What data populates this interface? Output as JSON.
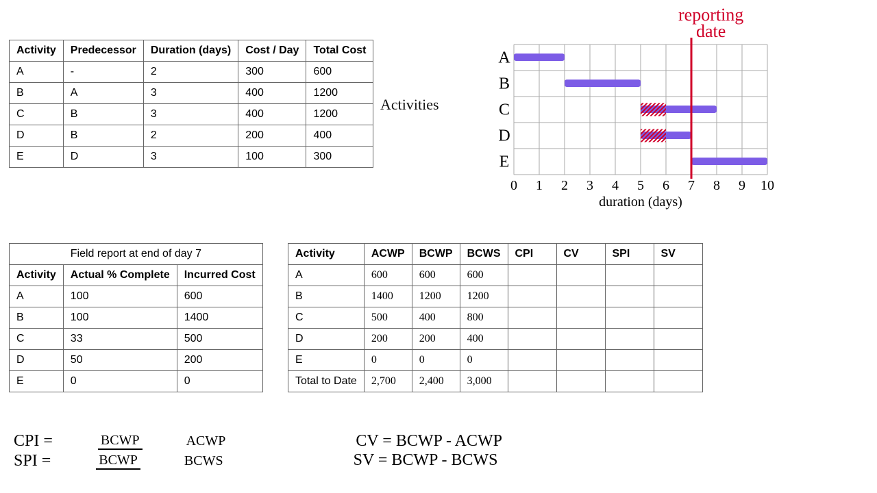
{
  "table1": {
    "headers": [
      "Activity",
      "Predecessor",
      "Duration (days)",
      "Cost / Day",
      "Total Cost"
    ],
    "rows": [
      [
        "A",
        "-",
        "2",
        "300",
        "600"
      ],
      [
        "B",
        "A",
        "3",
        "400",
        "1200"
      ],
      [
        "C",
        "B",
        "3",
        "400",
        "1200"
      ],
      [
        "D",
        "B",
        "2",
        "200",
        "400"
      ],
      [
        "E",
        "D",
        "3",
        "100",
        "300"
      ]
    ]
  },
  "table2": {
    "title": "Field report at end of day 7",
    "headers": [
      "Activity",
      "Actual % Complete",
      "Incurred Cost"
    ],
    "rows": [
      [
        "A",
        "100",
        "600"
      ],
      [
        "B",
        "100",
        "1400"
      ],
      [
        "C",
        "33",
        "500"
      ],
      [
        "D",
        "50",
        "200"
      ],
      [
        "E",
        "0",
        "0"
      ]
    ]
  },
  "table3": {
    "headers": [
      "Activity",
      "ACWP",
      "BCWP",
      "BCWS",
      "CPI",
      "CV",
      "SPI",
      "SV"
    ],
    "rows": [
      [
        "A",
        "600",
        "600",
        "600",
        "",
        "",
        "",
        ""
      ],
      [
        "B",
        "1400",
        "1200",
        "1200",
        "",
        "",
        "",
        ""
      ],
      [
        "C",
        "500",
        "400",
        "800",
        "",
        "",
        "",
        ""
      ],
      [
        "D",
        "200",
        "200",
        "400",
        "",
        "",
        "",
        ""
      ],
      [
        "E",
        "0",
        "0",
        "0",
        "",
        "",
        "",
        ""
      ],
      [
        "Total to Date",
        "2,700",
        "2,400",
        "3,000",
        "",
        "",
        "",
        ""
      ]
    ]
  },
  "labels": {
    "activities": "Activities",
    "reporting": "reporting\ndate",
    "xlabel": "duration (days)"
  },
  "formulas": {
    "cpi_lhs": "CPI =",
    "cpi_num": "BCWP",
    "cpi_den": "ACWP",
    "cv": "CV = BCWP - ACWP",
    "spi_lhs": "SPI =",
    "spi_num": "BCWP",
    "spi_den": "BCWS",
    "sv": "SV = BCWP - BCWS"
  },
  "chart_data": {
    "type": "bar",
    "title": "",
    "xlabel": "duration (days)",
    "ylabel": "Activities",
    "xlim": [
      0,
      10
    ],
    "categories": [
      "A",
      "B",
      "C",
      "D",
      "E"
    ],
    "xticks": [
      "0",
      "1",
      "2",
      "3",
      "4",
      "5",
      "6",
      "7",
      "8",
      "9",
      "10"
    ],
    "bars": [
      {
        "name": "A",
        "start": 0,
        "end": 2,
        "hatched": false
      },
      {
        "name": "B",
        "start": 2,
        "end": 5,
        "hatched": false
      },
      {
        "name": "C",
        "start": 5,
        "end": 8,
        "hatched": false
      },
      {
        "name": "D",
        "start": 5,
        "end": 7,
        "hatched": false
      },
      {
        "name": "E",
        "start": 7,
        "end": 10,
        "hatched": false
      }
    ],
    "hatched_segments": [
      {
        "name": "C",
        "start": 5,
        "end": 6
      },
      {
        "name": "D",
        "start": 5,
        "end": 6
      }
    ],
    "reporting_line_x": 7
  }
}
